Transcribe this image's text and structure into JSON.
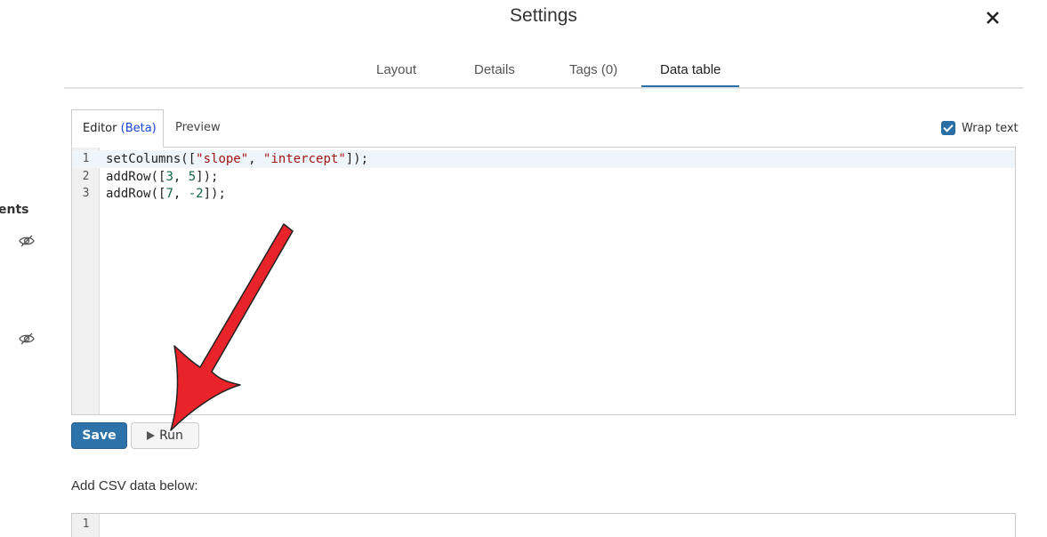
{
  "sidebar": {
    "partial_label": "ents",
    "icons": [
      "eye-slash-icon",
      "eye-slash-icon"
    ]
  },
  "dialog": {
    "title": "Settings",
    "close_icon": "close-icon",
    "tabs": [
      {
        "label": "Layout",
        "active": false
      },
      {
        "label": "Details",
        "active": false
      },
      {
        "label": "Tags (0)",
        "active": false
      },
      {
        "label": "Data table",
        "active": true
      }
    ]
  },
  "editor": {
    "tab_editor_label": "Editor",
    "tab_editor_badge": "(Beta)",
    "tab_preview_label": "Preview",
    "wrap_text_label": "Wrap text",
    "wrap_text_checked": true,
    "lines": [
      {
        "number": "1",
        "code": "setColumns([\"slope\", \"intercept\"]);"
      },
      {
        "number": "2",
        "code": "addRow([3, 5]);"
      },
      {
        "number": "3",
        "code": "addRow([7, -2]);"
      }
    ]
  },
  "buttons": {
    "save_label": "Save",
    "run_label": "Run"
  },
  "csv": {
    "label": "Add CSV data below:",
    "line_number": "1"
  },
  "colors": {
    "accent": "#2a6ea6",
    "save_button": "#2d72a8",
    "annotation_arrow": "#e8232a"
  }
}
